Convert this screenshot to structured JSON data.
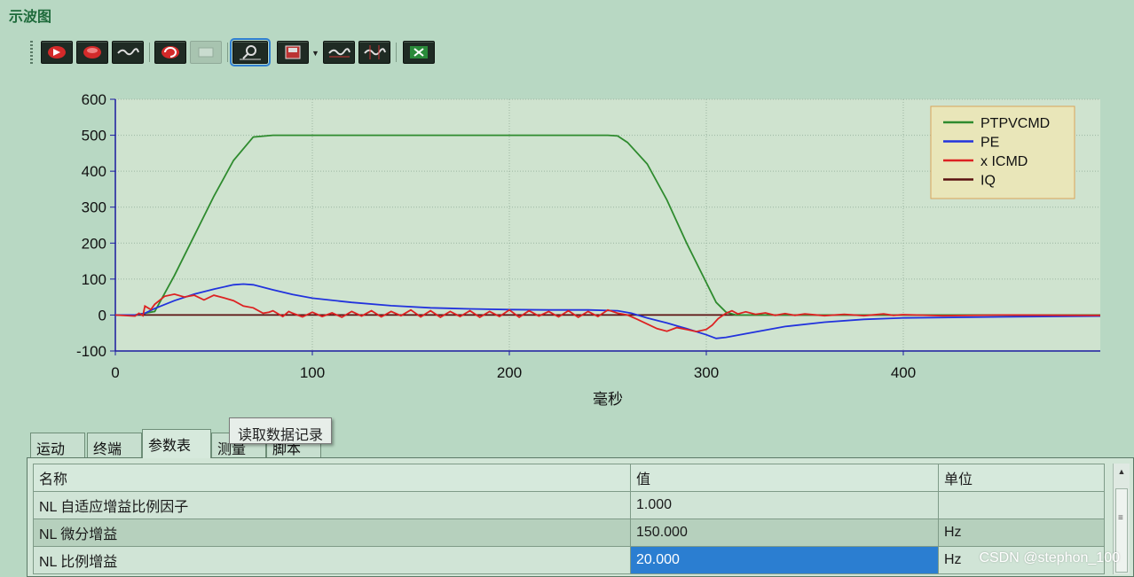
{
  "window": {
    "title": "示波图"
  },
  "toolbar": {
    "buttons": [
      {
        "icon": "record-play-icon"
      },
      {
        "icon": "record-stop-icon"
      },
      {
        "icon": "waveform-icon"
      },
      {
        "icon": "refresh-icon"
      },
      {
        "icon": "blank-icon",
        "disabled": true
      },
      {
        "icon": "zoom-icon",
        "active": true
      },
      {
        "icon": "save-icon",
        "has_dropdown": true
      },
      {
        "icon": "waveform-2-icon"
      },
      {
        "icon": "cursor-waveform-icon"
      },
      {
        "icon": "excel-export-icon"
      }
    ]
  },
  "chart_data": {
    "type": "line",
    "xlabel": "毫秒",
    "ylabel": "",
    "xlim": [
      0,
      500
    ],
    "ylim": [
      -100,
      600
    ],
    "x_ticks": [
      0,
      100,
      200,
      300,
      400
    ],
    "y_ticks": [
      600,
      500,
      400,
      300,
      200,
      100,
      0,
      -100
    ],
    "grid": true,
    "legend_position": "top-right",
    "series": [
      {
        "name": "PTPVCMD",
        "color": "#2e8b2e",
        "points": [
          [
            0,
            0
          ],
          [
            10,
            0
          ],
          [
            20,
            10
          ],
          [
            30,
            110
          ],
          [
            40,
            220
          ],
          [
            50,
            330
          ],
          [
            60,
            430
          ],
          [
            70,
            495
          ],
          [
            80,
            500
          ],
          [
            100,
            500
          ],
          [
            150,
            500
          ],
          [
            200,
            500
          ],
          [
            250,
            500
          ],
          [
            255,
            498
          ],
          [
            260,
            480
          ],
          [
            270,
            420
          ],
          [
            280,
            320
          ],
          [
            290,
            200
          ],
          [
            300,
            90
          ],
          [
            305,
            35
          ],
          [
            310,
            8
          ],
          [
            315,
            0
          ],
          [
            400,
            0
          ],
          [
            500,
            0
          ]
        ]
      },
      {
        "name": "PE",
        "color": "#2233dd",
        "points": [
          [
            0,
            0
          ],
          [
            10,
            0
          ],
          [
            15,
            5
          ],
          [
            20,
            18
          ],
          [
            30,
            40
          ],
          [
            40,
            58
          ],
          [
            50,
            72
          ],
          [
            60,
            84
          ],
          [
            65,
            86
          ],
          [
            70,
            84
          ],
          [
            80,
            70
          ],
          [
            90,
            57
          ],
          [
            100,
            47
          ],
          [
            120,
            35
          ],
          [
            140,
            26
          ],
          [
            160,
            20
          ],
          [
            180,
            17
          ],
          [
            200,
            15
          ],
          [
            220,
            14
          ],
          [
            240,
            14
          ],
          [
            255,
            12
          ],
          [
            262,
            5
          ],
          [
            270,
            -8
          ],
          [
            280,
            -22
          ],
          [
            290,
            -38
          ],
          [
            300,
            -55
          ],
          [
            305,
            -65
          ],
          [
            310,
            -62
          ],
          [
            320,
            -52
          ],
          [
            340,
            -32
          ],
          [
            360,
            -20
          ],
          [
            380,
            -12
          ],
          [
            400,
            -8
          ],
          [
            450,
            -5
          ],
          [
            500,
            -3
          ]
        ]
      },
      {
        "name": "x ICMD",
        "color": "#dd2222",
        "points": [
          [
            0,
            0
          ],
          [
            10,
            -3
          ],
          [
            12,
            5
          ],
          [
            14,
            -2
          ],
          [
            15,
            25
          ],
          [
            18,
            15
          ],
          [
            20,
            30
          ],
          [
            25,
            52
          ],
          [
            30,
            58
          ],
          [
            35,
            50
          ],
          [
            40,
            55
          ],
          [
            45,
            42
          ],
          [
            50,
            55
          ],
          [
            55,
            48
          ],
          [
            60,
            40
          ],
          [
            65,
            25
          ],
          [
            70,
            20
          ],
          [
            75,
            5
          ],
          [
            78,
            8
          ],
          [
            80,
            12
          ],
          [
            85,
            -4
          ],
          [
            88,
            10
          ],
          [
            90,
            5
          ],
          [
            95,
            -5
          ],
          [
            100,
            8
          ],
          [
            105,
            -4
          ],
          [
            110,
            6
          ],
          [
            115,
            -6
          ],
          [
            120,
            10
          ],
          [
            125,
            -3
          ],
          [
            130,
            12
          ],
          [
            135,
            -5
          ],
          [
            140,
            10
          ],
          [
            145,
            -2
          ],
          [
            150,
            14
          ],
          [
            155,
            -5
          ],
          [
            160,
            12
          ],
          [
            165,
            -6
          ],
          [
            170,
            10
          ],
          [
            175,
            -4
          ],
          [
            180,
            12
          ],
          [
            185,
            -6
          ],
          [
            190,
            10
          ],
          [
            195,
            -4
          ],
          [
            200,
            14
          ],
          [
            205,
            -6
          ],
          [
            210,
            12
          ],
          [
            215,
            -3
          ],
          [
            220,
            10
          ],
          [
            225,
            -5
          ],
          [
            230,
            12
          ],
          [
            235,
            -6
          ],
          [
            240,
            10
          ],
          [
            245,
            -4
          ],
          [
            250,
            14
          ],
          [
            255,
            5
          ],
          [
            260,
            0
          ],
          [
            265,
            -12
          ],
          [
            270,
            -25
          ],
          [
            275,
            -38
          ],
          [
            280,
            -45
          ],
          [
            285,
            -35
          ],
          [
            290,
            -40
          ],
          [
            295,
            -46
          ],
          [
            300,
            -40
          ],
          [
            303,
            -28
          ],
          [
            306,
            -10
          ],
          [
            310,
            5
          ],
          [
            313,
            12
          ],
          [
            316,
            3
          ],
          [
            320,
            9
          ],
          [
            325,
            2
          ],
          [
            330,
            6
          ],
          [
            335,
            -1
          ],
          [
            340,
            4
          ],
          [
            345,
            -1
          ],
          [
            350,
            3
          ],
          [
            360,
            -2
          ],
          [
            370,
            2
          ],
          [
            380,
            -2
          ],
          [
            390,
            3
          ],
          [
            395,
            -1
          ],
          [
            400,
            1
          ],
          [
            420,
            -2
          ],
          [
            450,
            0
          ],
          [
            500,
            -1
          ]
        ]
      },
      {
        "name": "IQ",
        "color": "#5a1010",
        "points": [
          [
            0,
            0
          ],
          [
            500,
            0
          ]
        ]
      }
    ]
  },
  "tooltip": {
    "text": "读取数据记录"
  },
  "tabs": [
    {
      "label": "运动"
    },
    {
      "label": "终端"
    },
    {
      "label": "参数表",
      "active": true
    },
    {
      "label": "测量"
    },
    {
      "label": "脚本"
    }
  ],
  "table": {
    "headers": [
      "名称",
      "值",
      "单位"
    ],
    "rows": [
      {
        "name": "NL 自适应增益比例因子",
        "value": "1.000",
        "unit": ""
      },
      {
        "name": "NL 微分增益",
        "value": "150.000",
        "unit": "Hz"
      },
      {
        "name": "NL 比例增益",
        "value": "20.000",
        "unit": "Hz",
        "selected_value": true
      }
    ]
  },
  "watermark": {
    "text": "CSDN @stephon_100"
  }
}
